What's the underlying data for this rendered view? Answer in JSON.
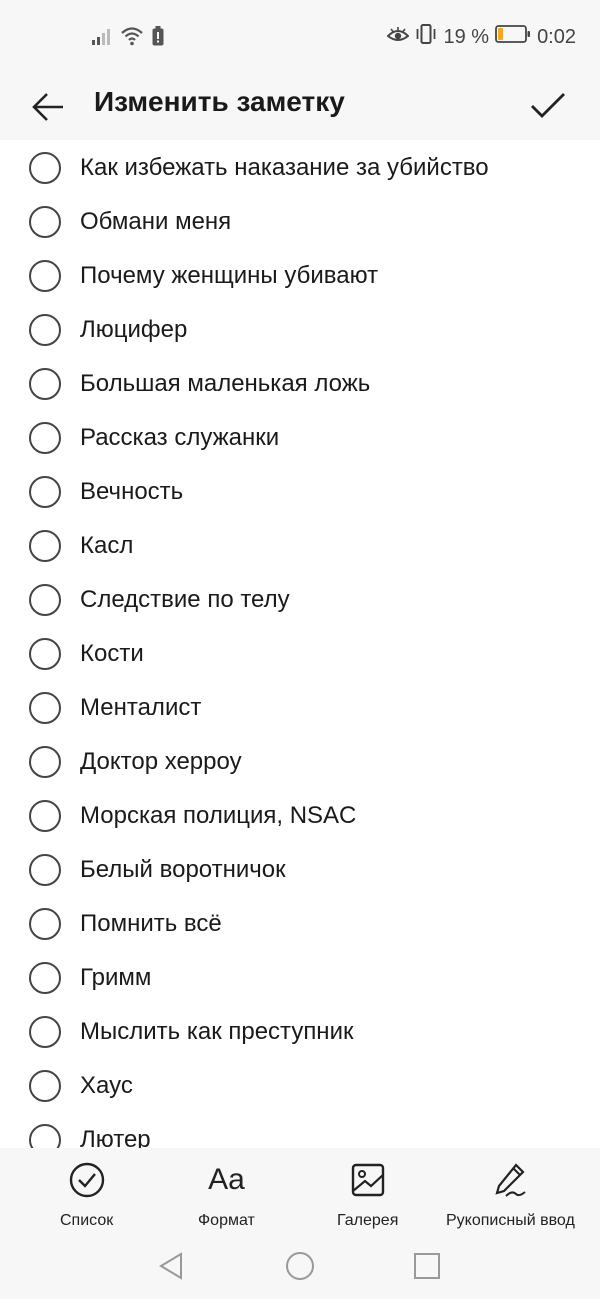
{
  "status_bar": {
    "battery_text": "19 %",
    "time": "0:02",
    "battery_level": 0.19,
    "battery_color": "#f5a623"
  },
  "header": {
    "title": "Изменить заметку",
    "back_icon": "arrow-left-icon",
    "confirm_icon": "checkmark-icon"
  },
  "checklist": [
    {
      "label": "Как избежать наказание за убийство",
      "checked": false
    },
    {
      "label": "Обмани меня",
      "checked": false
    },
    {
      "label": "Почему женщины убивают",
      "checked": false
    },
    {
      "label": "Люцифер",
      "checked": false
    },
    {
      "label": "Большая маленькая ложь",
      "checked": false
    },
    {
      "label": "Рассказ служанки",
      "checked": false
    },
    {
      "label": "Вечность",
      "checked": false
    },
    {
      "label": "Касл",
      "checked": false
    },
    {
      "label": "Следствие по телу",
      "checked": false
    },
    {
      "label": "Кости",
      "checked": false
    },
    {
      "label": "Менталист",
      "checked": false
    },
    {
      "label": "Доктор херроу",
      "checked": false
    },
    {
      "label": "Морская полиция, NSAC",
      "checked": false
    },
    {
      "label": "Белый воротничок",
      "checked": false
    },
    {
      "label": "Помнить всё",
      "checked": false
    },
    {
      "label": "Гримм",
      "checked": false
    },
    {
      "label": "Мыслить как преступник",
      "checked": false
    },
    {
      "label": "Хаус",
      "checked": false
    },
    {
      "label": "Лютер",
      "checked": false
    }
  ],
  "toolbar": {
    "list_label": "Список",
    "format_label": "Формат",
    "format_glyph": "Aa",
    "gallery_label": "Галерея",
    "handwriting_label": "Рукописный ввод"
  },
  "navbar": {
    "back_icon": "triangle-back-icon",
    "home_icon": "circle-home-icon",
    "recents_icon": "square-recents-icon"
  }
}
